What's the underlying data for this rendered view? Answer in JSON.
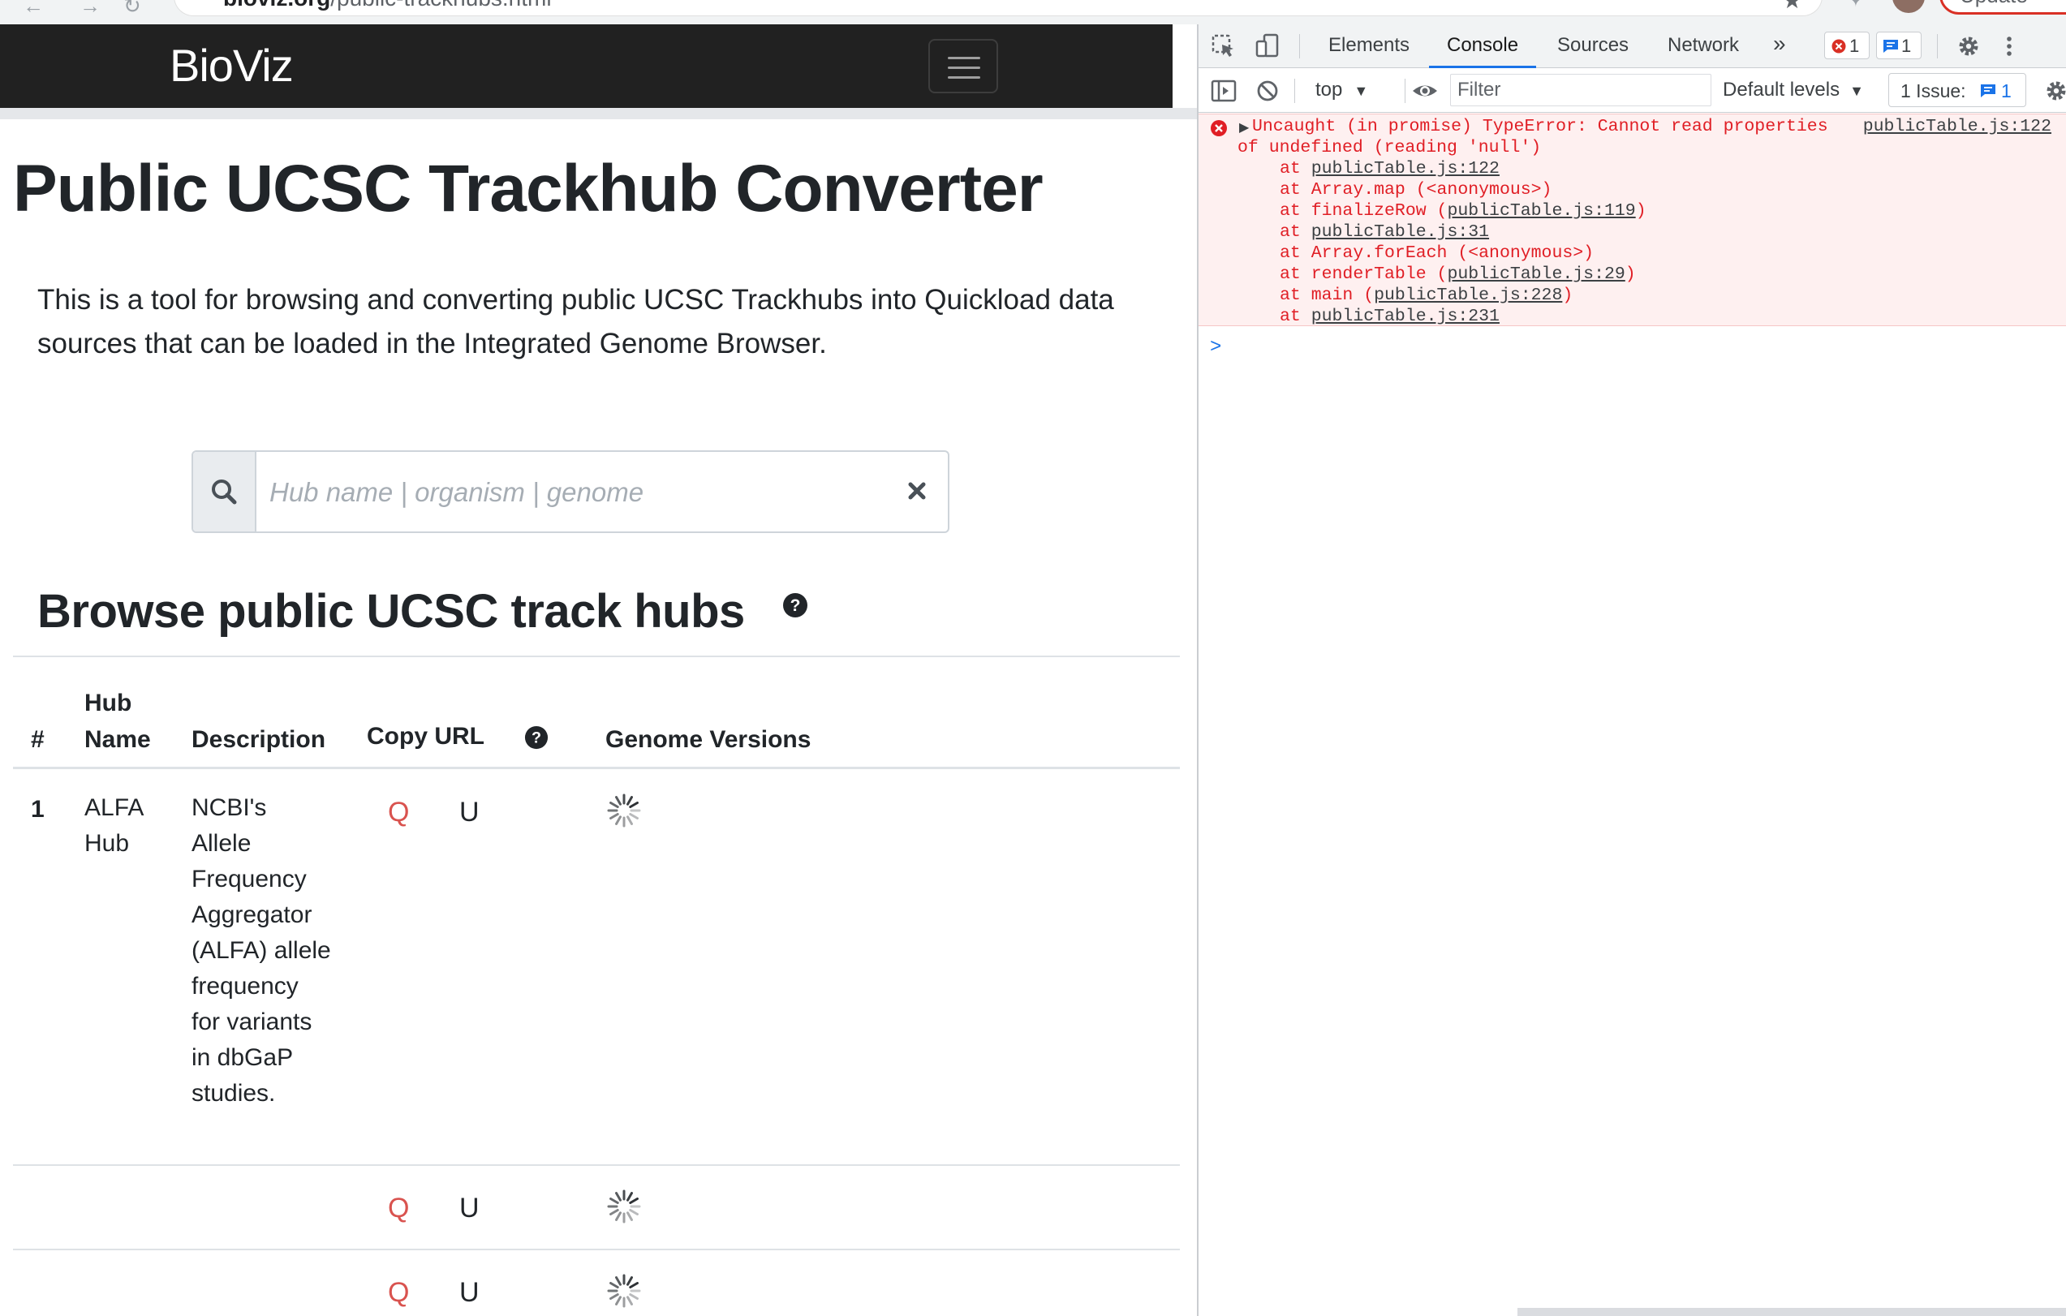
{
  "browser": {
    "url_host": "bioviz.org",
    "url_path": "/public-trackhubs.html",
    "update_label": "Update"
  },
  "navbar": {
    "brand": "BioViz"
  },
  "main": {
    "title": "Public UCSC Trackhub Converter",
    "intro": "This is a tool for browsing and converting public UCSC Trackhubs into Quickload data sources that can be loaded in the Integrated Genome Browser.",
    "search": {
      "placeholder": "Hub name | organism | genome",
      "value": ""
    },
    "browse_title": "Browse public UCSC track hubs",
    "table": {
      "headers": {
        "num": "#",
        "hub_name_1": "Hub",
        "hub_name_2": "Name",
        "description": "Description",
        "copy_url": "Copy URL",
        "genome_versions": "Genome Versions"
      },
      "rows": [
        {
          "num": "1",
          "hub_name_lines": [
            "ALFA",
            "Hub"
          ],
          "description_lines": [
            "NCBI's",
            "Allele",
            "Frequency",
            "Aggregator",
            "(ALFA) allele",
            "frequency",
            "for variants",
            "in dbGaP",
            "studies."
          ],
          "copy_q": "Q",
          "copy_u": "U"
        },
        {
          "num": "",
          "copy_q": "Q",
          "copy_u": "U"
        },
        {
          "num": "",
          "copy_q": "Q",
          "copy_u": "U"
        }
      ]
    }
  },
  "devtools": {
    "tabs": [
      "Elements",
      "Console",
      "Sources",
      "Network"
    ],
    "active_tab": "Console",
    "more_tabs": "»",
    "error_count": "1",
    "message_count": "1",
    "toolbar": {
      "context": "top",
      "filter_placeholder": "Filter",
      "levels": "Default levels",
      "issues_label": "1 Issue:",
      "issues_count": "1"
    },
    "error": {
      "line1": "Uncaught (in promise) TypeError: Cannot read properties",
      "line2": "of undefined (reading 'null')",
      "source": "publicTable.js:122",
      "stack": [
        {
          "prefix": "at ",
          "fn": "",
          "link": "publicTable.js:122",
          "suffix": ""
        },
        {
          "prefix": "at ",
          "fn": "Array.map (<anonymous>)",
          "link": "",
          "suffix": ""
        },
        {
          "prefix": "at ",
          "fn": "finalizeRow (",
          "link": "publicTable.js:119",
          "suffix": ")"
        },
        {
          "prefix": "at ",
          "fn": "",
          "link": "publicTable.js:31",
          "suffix": ""
        },
        {
          "prefix": "at ",
          "fn": "Array.forEach (<anonymous>)",
          "link": "",
          "suffix": ""
        },
        {
          "prefix": "at ",
          "fn": "renderTable (",
          "link": "publicTable.js:29",
          "suffix": ")"
        },
        {
          "prefix": "at ",
          "fn": "main (",
          "link": "publicTable.js:228",
          "suffix": ")"
        },
        {
          "prefix": "at ",
          "fn": "",
          "link": "publicTable.js:231",
          "suffix": ""
        }
      ]
    },
    "prompt": ">"
  },
  "colors": {
    "navbar_bg": "#212121",
    "copy_q": "#d9534f",
    "error_text": "#e01e25",
    "error_bg": "#fef0f0",
    "devtools_accent": "#1a73e8"
  }
}
